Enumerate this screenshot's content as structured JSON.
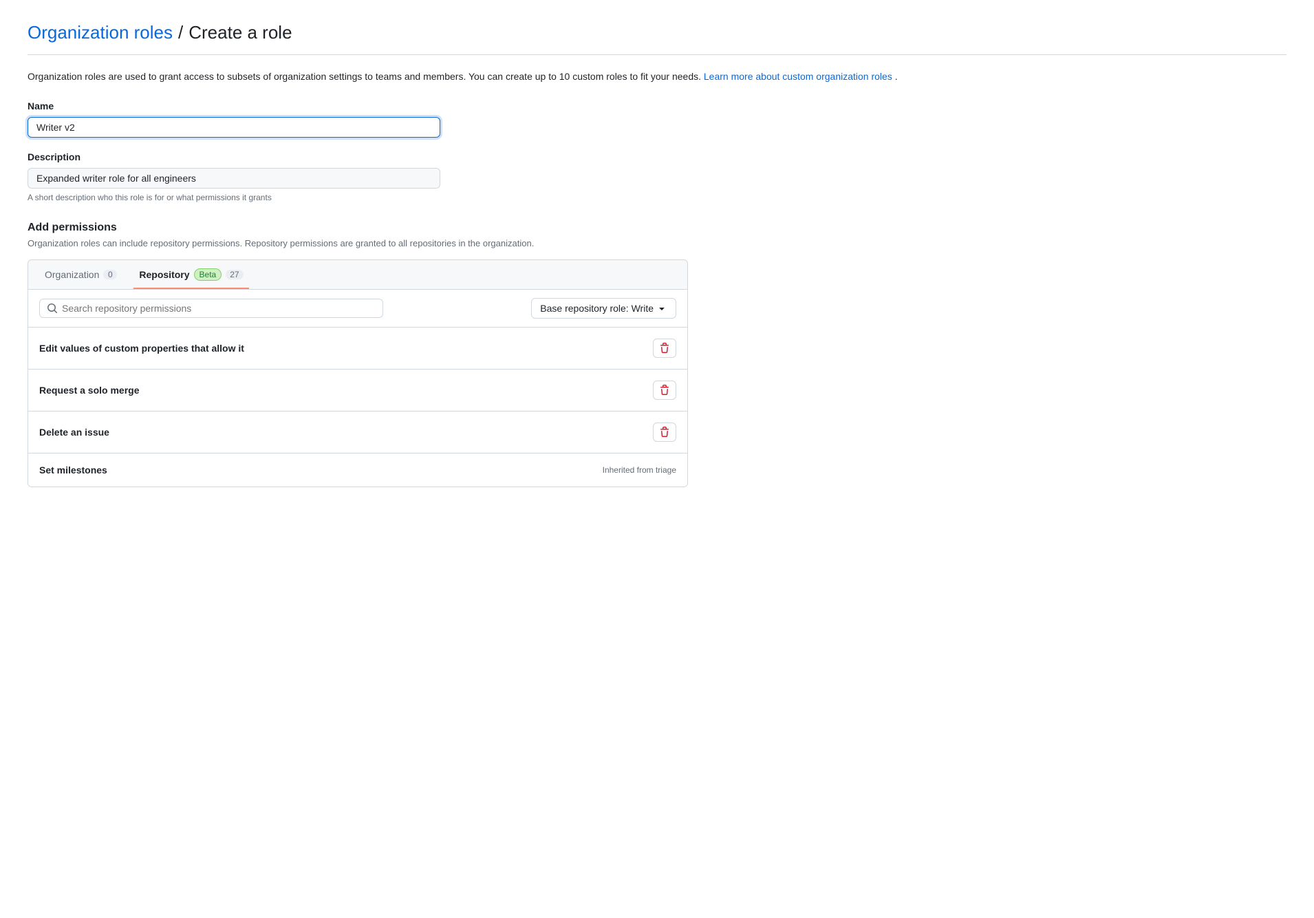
{
  "breadcrumb": {
    "link_label": "Organization roles",
    "separator": "/",
    "current": "Create a role"
  },
  "intro": {
    "text": "Organization roles are used to grant access to subsets of organization settings to teams and members. You can create up to 10 custom roles to fit your needs.",
    "link_text": "Learn more about custom organization roles",
    "link_suffix": "."
  },
  "form": {
    "name_label": "Name",
    "name_value": "Writer v2",
    "description_label": "Description",
    "description_value": "Expanded writer role for all engineers",
    "description_hint": "A short description who this role is for or what permissions it grants"
  },
  "permissions": {
    "title": "Add permissions",
    "subtitle": "Organization roles can include repository permissions. Repository permissions are granted to all repositories in the organization.",
    "tabs": [
      {
        "label": "Organization",
        "badge": "0",
        "badge_type": "gray",
        "active": false
      },
      {
        "label": "Repository",
        "badge": "Beta",
        "badge2": "27",
        "badge_type": "green",
        "active": true
      }
    ],
    "search_placeholder": "Search repository permissions",
    "base_role_label": "Base repository role: Write",
    "permission_rows": [
      {
        "name": "Edit values of custom properties that allow it",
        "inherited": null
      },
      {
        "name": "Request a solo merge",
        "inherited": null
      },
      {
        "name": "Delete an issue",
        "inherited": null
      },
      {
        "name": "Set milestones",
        "inherited": "Inherited from triage"
      }
    ]
  }
}
